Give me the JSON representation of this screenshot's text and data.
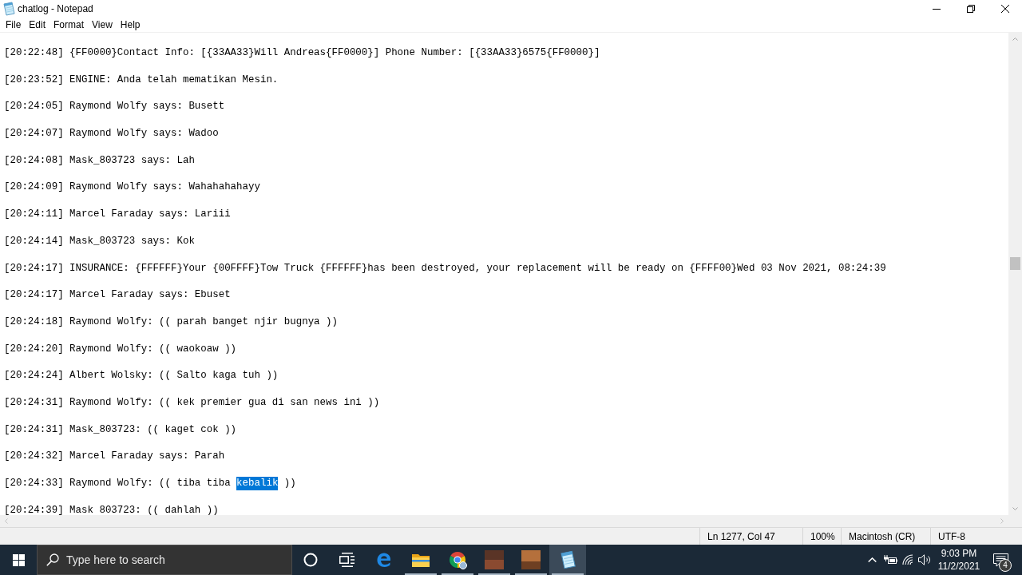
{
  "window": {
    "title": "chatlog - Notepad"
  },
  "menu": [
    "File",
    "Edit",
    "Format",
    "View",
    "Help"
  ],
  "editor": {
    "lines": [
      {
        "segments": [
          {
            "text": "[20:22:48] {FF0000}Contact Info: [{33AA33}Will Andreas{FF0000}] Phone Number: [{33AA33}6575{FF0000}]",
            "selected": false
          }
        ]
      },
      {
        "segments": [
          {
            "text": "[20:23:52] ENGINE: Anda telah mematikan Mesin.",
            "selected": false
          }
        ]
      },
      {
        "segments": [
          {
            "text": "[20:24:05] Raymond Wolfy says: Busett",
            "selected": false
          }
        ]
      },
      {
        "segments": [
          {
            "text": "[20:24:07] Raymond Wolfy says: Wadoo",
            "selected": false
          }
        ]
      },
      {
        "segments": [
          {
            "text": "[20:24:08] Mask_803723 says: Lah",
            "selected": false
          }
        ]
      },
      {
        "segments": [
          {
            "text": "[20:24:09] Raymond Wolfy says: Wahahahahayy",
            "selected": false
          }
        ]
      },
      {
        "segments": [
          {
            "text": "[20:24:11] Marcel Faraday says: Lariii",
            "selected": false
          }
        ]
      },
      {
        "segments": [
          {
            "text": "[20:24:14] Mask_803723 says: Kok",
            "selected": false
          }
        ]
      },
      {
        "segments": [
          {
            "text": "[20:24:17] INSURANCE: {FFFFFF}Your {00FFFF}Tow Truck {FFFFFF}has been destroyed, your replacement will be ready on {FFFF00}Wed 03 Nov 2021, 08:24:39",
            "selected": false
          }
        ]
      },
      {
        "segments": [
          {
            "text": "[20:24:17] Marcel Faraday says: Ebuset",
            "selected": false
          }
        ]
      },
      {
        "segments": [
          {
            "text": "[20:24:18] Raymond Wolfy: (( parah banget njir bugnya ))",
            "selected": false
          }
        ]
      },
      {
        "segments": [
          {
            "text": "[20:24:20] Raymond Wolfy: (( waokoaw ))",
            "selected": false
          }
        ]
      },
      {
        "segments": [
          {
            "text": "[20:24:24] Albert Wolsky: (( Salto kaga tuh ))",
            "selected": false
          }
        ]
      },
      {
        "segments": [
          {
            "text": "[20:24:31] Raymond Wolfy: (( kek premier gua di san news ini ))",
            "selected": false
          }
        ]
      },
      {
        "segments": [
          {
            "text": "[20:24:31] Mask_803723: (( kaget cok ))",
            "selected": false
          }
        ]
      },
      {
        "segments": [
          {
            "text": "[20:24:32] Marcel Faraday says: Parah",
            "selected": false
          }
        ]
      },
      {
        "segments": [
          {
            "text": "[20:24:33] Raymond Wolfy: (( tiba tiba ",
            "selected": false
          },
          {
            "text": "kebalik",
            "selected": true
          },
          {
            "text": " ))",
            "selected": false
          }
        ]
      },
      {
        "segments": [
          {
            "text": "[20:24:39] Mask 803723: (( dahlah ))",
            "selected": false
          }
        ]
      }
    ]
  },
  "status_bar": {
    "position": "Ln 1277, Col 47",
    "zoom": "100%",
    "line_ending": "Macintosh (CR)",
    "encoding": "UTF-8"
  },
  "taskbar": {
    "search": {
      "placeholder": "Type here to search"
    },
    "buttons": [
      {
        "kind": "cortana",
        "running": false,
        "selected": false
      },
      {
        "kind": "task_view",
        "running": false,
        "selected": false
      },
      {
        "kind": "edge",
        "running": false,
        "selected": false
      },
      {
        "kind": "explorer",
        "running": true,
        "selected": false
      },
      {
        "kind": "chrome",
        "running": true,
        "selected": false
      },
      {
        "kind": "picture",
        "running": true,
        "selected": false
      },
      {
        "kind": "picture",
        "running": true,
        "selected": false
      },
      {
        "kind": "notepad",
        "running": true,
        "selected": true
      }
    ],
    "clock": {
      "time": "9:03 PM",
      "date": "11/2/2021"
    },
    "notifications": {
      "count": "4"
    }
  }
}
